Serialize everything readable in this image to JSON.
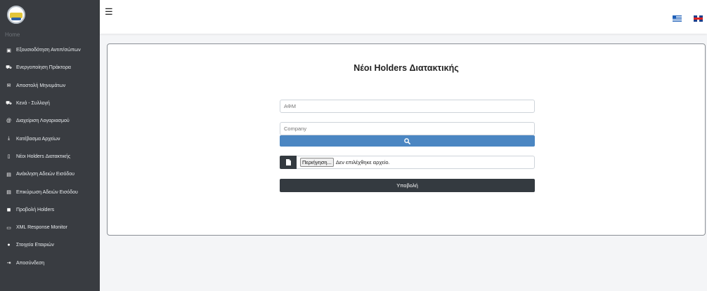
{
  "sidebar": {
    "home_label": "Home",
    "items": [
      {
        "icon": "id-card-icon",
        "glyph": "▣",
        "label": "Εξουσιοδότηση Αντιπ/σώπων"
      },
      {
        "icon": "truck-loading-icon",
        "glyph": "⛟",
        "label": "Ενεργοποίηση Πράκτορα"
      },
      {
        "icon": "envelope-icon",
        "glyph": "✉",
        "label": "Αποστολή Μηνυμάτων"
      },
      {
        "icon": "truck-icon",
        "glyph": "⛟",
        "label": "Κενά - Συλλογή"
      },
      {
        "icon": "at-sign-icon",
        "glyph": "@",
        "label": "Διαχείριση Λογαριασμού"
      },
      {
        "icon": "download-icon",
        "glyph": "⤓",
        "label": "Κατέβασμα Αρχείων"
      },
      {
        "icon": "bookmark-icon",
        "glyph": "▯",
        "label": "Νέοι Holders Διατακτικής"
      },
      {
        "icon": "calendar-x-icon",
        "glyph": "▤",
        "label": "Ανάκληση Αδειών Εισόδου"
      },
      {
        "icon": "calendar-check-icon",
        "glyph": "▤",
        "label": "Επικύρωση Αδειών Εισόδου"
      },
      {
        "icon": "square-check-icon",
        "glyph": "◼",
        "label": "Προβολή Holders"
      },
      {
        "icon": "monitor-icon",
        "glyph": "▭",
        "label": "XML Response Monitor"
      },
      {
        "icon": "info-circle-icon",
        "glyph": "●",
        "label": "Στοιχεία Εταιριών"
      },
      {
        "icon": "sign-out-icon",
        "glyph": "⇥",
        "label": "Αποσύνδεση"
      }
    ]
  },
  "topbar": {
    "menu_icon": "hamburger-icon",
    "flags": [
      "greek-flag-icon",
      "uk-flag-icon"
    ]
  },
  "form": {
    "title": "Νέοι Holders Διατακτικής",
    "afm_placeholder": "ΑΦΜ",
    "company_placeholder": "Company",
    "browse_label": "Περιήγηση...",
    "no_file_label": "Δεν επιλέχθηκε αρχείο.",
    "submit_label": "Υποβολή"
  },
  "colors": {
    "sidebar_bg": "#393c41",
    "search_button": "#4b86c2",
    "submit_button": "#343a40"
  }
}
